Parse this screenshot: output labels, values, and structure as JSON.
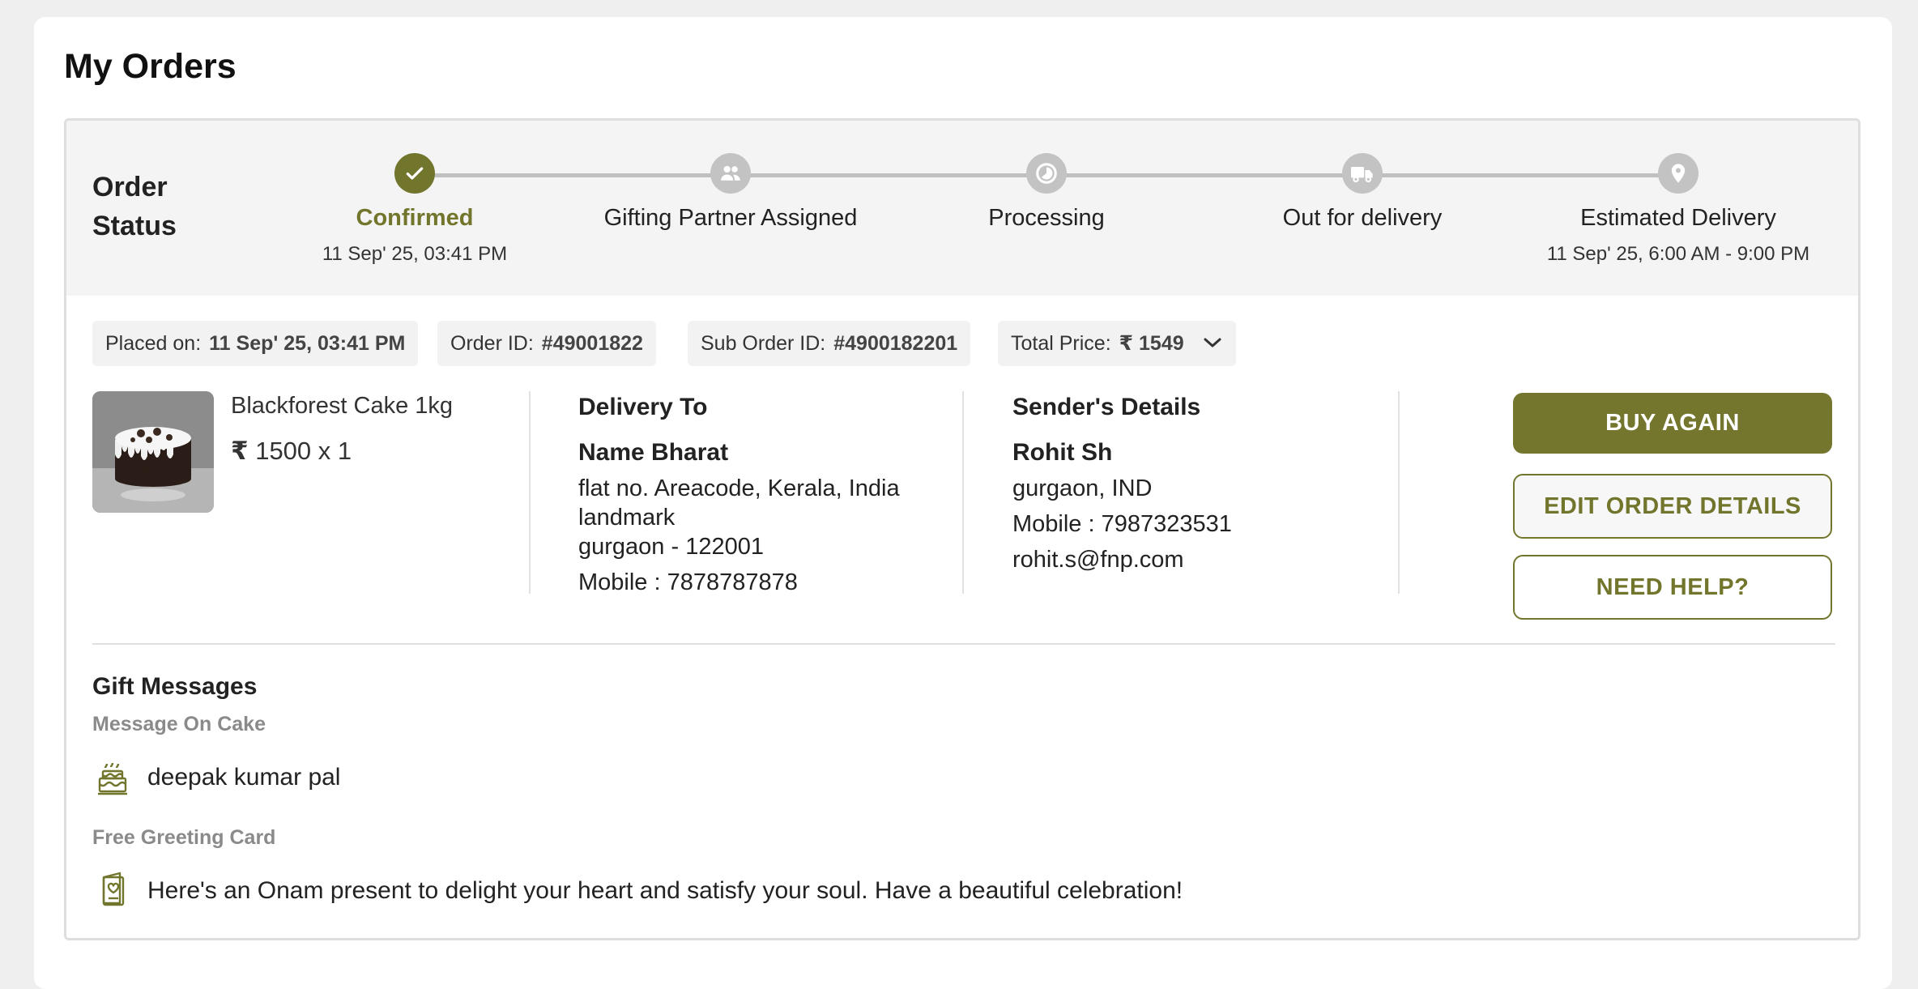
{
  "page": {
    "title": "My Orders"
  },
  "colors": {
    "accent": "#72752c",
    "pending": "#c3c3c3",
    "band": "#f4f4f4"
  },
  "order_status": {
    "heading": "Order Status",
    "steps": [
      {
        "label": "Confirmed",
        "date": "11 Sep' 25, 03:41 PM",
        "done": true,
        "icon": "check-icon"
      },
      {
        "label": "Gifting Partner Assigned",
        "date": "",
        "done": false,
        "icon": "users-icon"
      },
      {
        "label": "Processing",
        "date": "",
        "done": false,
        "icon": "processing-icon"
      },
      {
        "label": "Out for delivery",
        "date": "",
        "done": false,
        "icon": "truck-icon"
      },
      {
        "label": "Estimated Delivery",
        "date": "11 Sep' 25, 6:00 AM - 9:00 PM",
        "done": false,
        "icon": "location-pin-icon"
      }
    ]
  },
  "summary": {
    "placed_label": "Placed on:",
    "placed_value": "11 Sep' 25, 03:41 PM",
    "order_id_label": "Order ID:",
    "order_id_value": "#49001822",
    "sub_order_label": "Sub Order ID:",
    "sub_order_value": "#4900182201",
    "total_label": "Total Price:",
    "currency_symbol": "₹",
    "total_value": "1549"
  },
  "product": {
    "name": "Blackforest Cake 1kg",
    "currency_symbol": "₹",
    "price_qty": "1500 x 1"
  },
  "delivery": {
    "title": "Delivery To",
    "name": "Name Bharat",
    "address_line1": "flat no. Areacode, Kerala, India",
    "address_line2": "landmark",
    "address_line3": "gurgaon - 122001",
    "mobile": "Mobile : 7878787878"
  },
  "sender": {
    "title": "Sender's Details",
    "name": "Rohit Sh",
    "location": "gurgaon, IND",
    "mobile": "Mobile : 7987323531",
    "email": "rohit.s@fnp.com"
  },
  "actions": {
    "buy_again": "BUY AGAIN",
    "edit_order": "EDIT ORDER DETAILS",
    "need_help": "NEED HELP?"
  },
  "gift": {
    "title": "Gift Messages",
    "cake_label": "Message On Cake",
    "cake_icon": "cake-icon",
    "cake_message": "deepak kumar pal",
    "card_label": "Free Greeting Card",
    "card_icon": "greeting-card-icon",
    "card_message": "Here's an Onam present to delight your heart and satisfy your soul. Have a beautiful celebration!"
  }
}
